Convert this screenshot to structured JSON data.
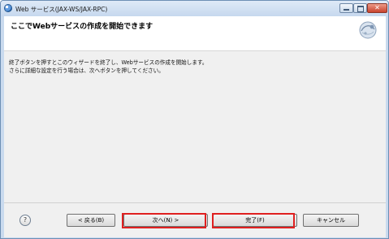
{
  "window": {
    "title": "Web サービス(JAX-WS/JAX-RPC)",
    "close_glyph": "✕"
  },
  "header": {
    "title": "ここでWebサービスの作成を開始できます"
  },
  "content": {
    "description_line1": "終了ボタンを押すとこのウィザードを終了し、Webサービスの作成を開始します。",
    "description_line2": "さらに詳細な設定を行う場合は、次へボタンを押してください。"
  },
  "footer": {
    "help_glyph": "?",
    "back_label": "< 戻る(B)",
    "next_label": "次へ(N) >",
    "finish_label": "完了(F)",
    "cancel_label": "キャンセル"
  },
  "icons": {
    "app": "eclipse-icon",
    "wizard": "web-service-wizard-icon"
  },
  "colors": {
    "highlight": "#e02020",
    "title_bar": "#c6d8ee",
    "dialog_bg": "#f0f0f0"
  }
}
